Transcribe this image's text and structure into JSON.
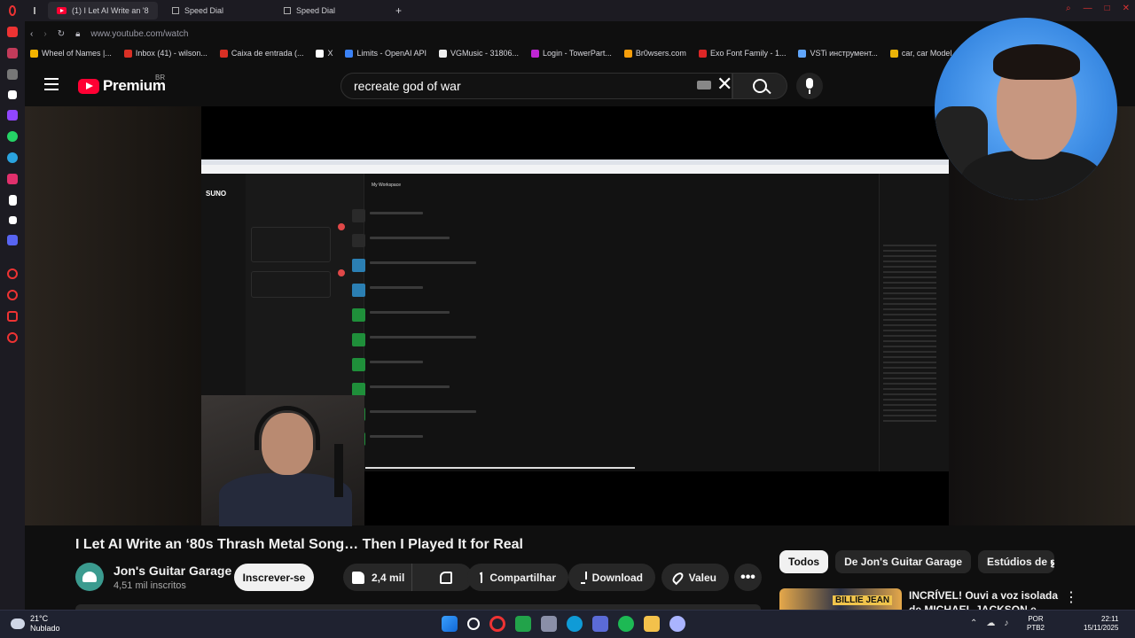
{
  "browser": {
    "tabs": [
      {
        "label": "(1) I Let AI Write an '8"
      },
      {
        "label": "Speed Dial"
      },
      {
        "label": "Speed Dial"
      }
    ],
    "url": "www.youtube.com/watch",
    "bookmarks": [
      {
        "label": "Wheel of Names |...",
        "color": "#f4b400"
      },
      {
        "label": "Inbox (41) - wilson...",
        "color": "#d93025"
      },
      {
        "label": "Caixa de entrada (...",
        "color": "#d93025"
      },
      {
        "label": "X",
        "color": "#ffffff"
      },
      {
        "label": "Limits - OpenAI API",
        "color": "#3b82f6"
      },
      {
        "label": "VGMusic - 31806...",
        "color": "#eeeeee"
      },
      {
        "label": "Login - TowerPart...",
        "color": "#c026d3"
      },
      {
        "label": "Br0wsers.com",
        "color": "#f59e0b"
      },
      {
        "label": "Exo Font Family - 1...",
        "color": "#dc2626"
      },
      {
        "label": "VSTi инструмент...",
        "color": "#60a5fa"
      },
      {
        "label": "car, car Model do...",
        "color": "#eab308"
      }
    ]
  },
  "youtube": {
    "logo_text": "Premium",
    "region": "BR",
    "search_query": "recreate god of war",
    "video": {
      "title": "I Let AI Write an ‘80s Thrash Metal Song… Then I Played It for Real",
      "suno_logo": "SUNO",
      "suno_workspace": "My Workspace"
    },
    "channel": {
      "name": "Jon's Guitar Garage",
      "subscribers": "4,51 mil inscritos"
    },
    "actions": {
      "subscribe": "Inscrever-se",
      "likes": "2,4 mil",
      "share": "Compartilhar",
      "download": "Download",
      "thanks": "Valeu",
      "more": "•••"
    },
    "chips": [
      "Todos",
      "De Jon's Guitar Garage",
      "Estúdios de gr"
    ],
    "recommendation": {
      "thumb_text": "BILLIE JEAN",
      "title": "INCRÍVEL! Ouvi a voz isolada de MICHAEL JACKSON e fiquei"
    }
  },
  "taskbar": {
    "weather_temp": "21°C",
    "weather_desc": "Nublado",
    "lang_top": "POR",
    "lang_bottom": "PTB2",
    "time": "22:11",
    "date": "15/11/2025"
  }
}
